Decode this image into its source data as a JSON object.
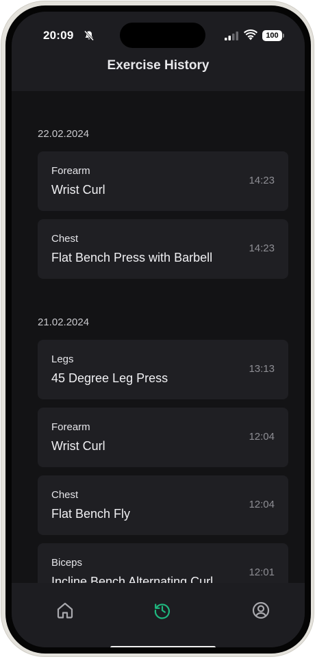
{
  "status_bar": {
    "time": "20:09",
    "battery": "100",
    "icons": [
      "bell-slash-icon",
      "signal-icon",
      "wifi-icon",
      "battery-icon"
    ]
  },
  "header": {
    "title": "Exercise History"
  },
  "history": [
    {
      "date": "22.02.2024",
      "entries": [
        {
          "category": "Forearm",
          "exercise": "Wrist Curl",
          "time": "14:23"
        },
        {
          "category": "Chest",
          "exercise": "Flat Bench Press with Barbell",
          "time": "14:23"
        }
      ]
    },
    {
      "date": "21.02.2024",
      "entries": [
        {
          "category": "Legs",
          "exercise": "45 Degree Leg Press",
          "time": "13:13"
        },
        {
          "category": "Forearm",
          "exercise": "Wrist Curl",
          "time": "12:04"
        },
        {
          "category": "Chest",
          "exercise": "Flat Bench Fly",
          "time": "12:04"
        },
        {
          "category": "Biceps",
          "exercise": "Incline Bench Alternating Curl",
          "time": "12:01"
        }
      ]
    }
  ],
  "tabbar": {
    "tabs": [
      {
        "icon": "home-icon",
        "active": false
      },
      {
        "icon": "history-icon",
        "active": true
      },
      {
        "icon": "profile-icon",
        "active": false
      }
    ],
    "active_color": "#1fb87f",
    "inactive_color": "#a9a9ae"
  }
}
